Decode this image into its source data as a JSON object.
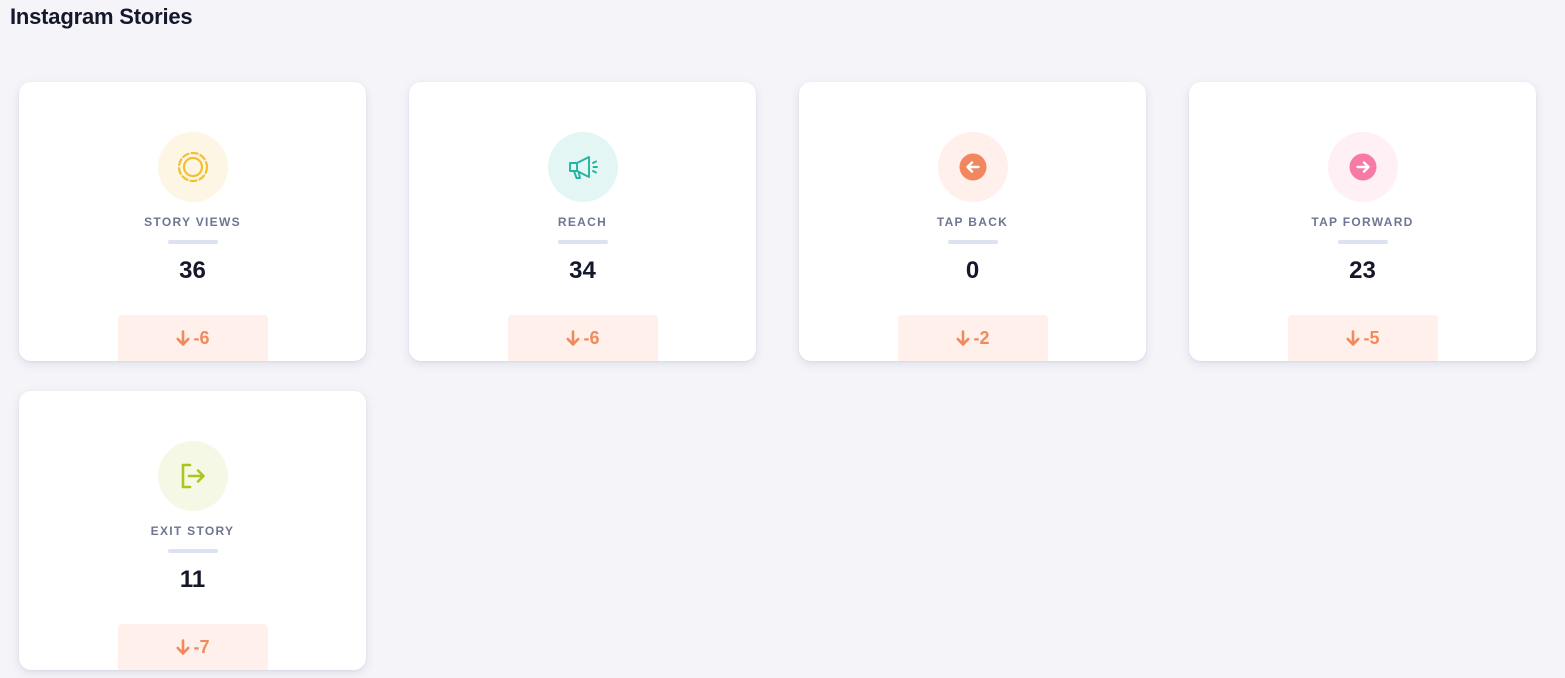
{
  "page": {
    "title": "Instagram Stories"
  },
  "cards": [
    {
      "label": "STORY VIEWS",
      "value": "36",
      "delta": "-6",
      "icon": "circle-dashed-icon",
      "icon_color": "#f2c02f",
      "icon_bg": "#fdf6e4",
      "delta_color": "#f08a5d"
    },
    {
      "label": "REACH",
      "value": "34",
      "delta": "-6",
      "icon": "megaphone-icon",
      "icon_color": "#26b3a0",
      "icon_bg": "#e4f6f4",
      "delta_color": "#f08a5d"
    },
    {
      "label": "TAP BACK",
      "value": "0",
      "delta": "-2",
      "icon": "arrow-left-circle-icon",
      "icon_color": "#f2875f",
      "icon_bg": "#fff0ec",
      "delta_color": "#f08a5d"
    },
    {
      "label": "TAP FORWARD",
      "value": "23",
      "delta": "-5",
      "icon": "arrow-right-circle-icon",
      "icon_color": "#f779a6",
      "icon_bg": "#fff0f5",
      "delta_color": "#f08a5d"
    },
    {
      "label": "EXIT STORY",
      "value": "11",
      "delta": "-7",
      "icon": "logout-icon",
      "icon_color": "#a8c61e",
      "icon_bg": "#f4f8e5",
      "delta_color": "#f08a5d"
    }
  ]
}
